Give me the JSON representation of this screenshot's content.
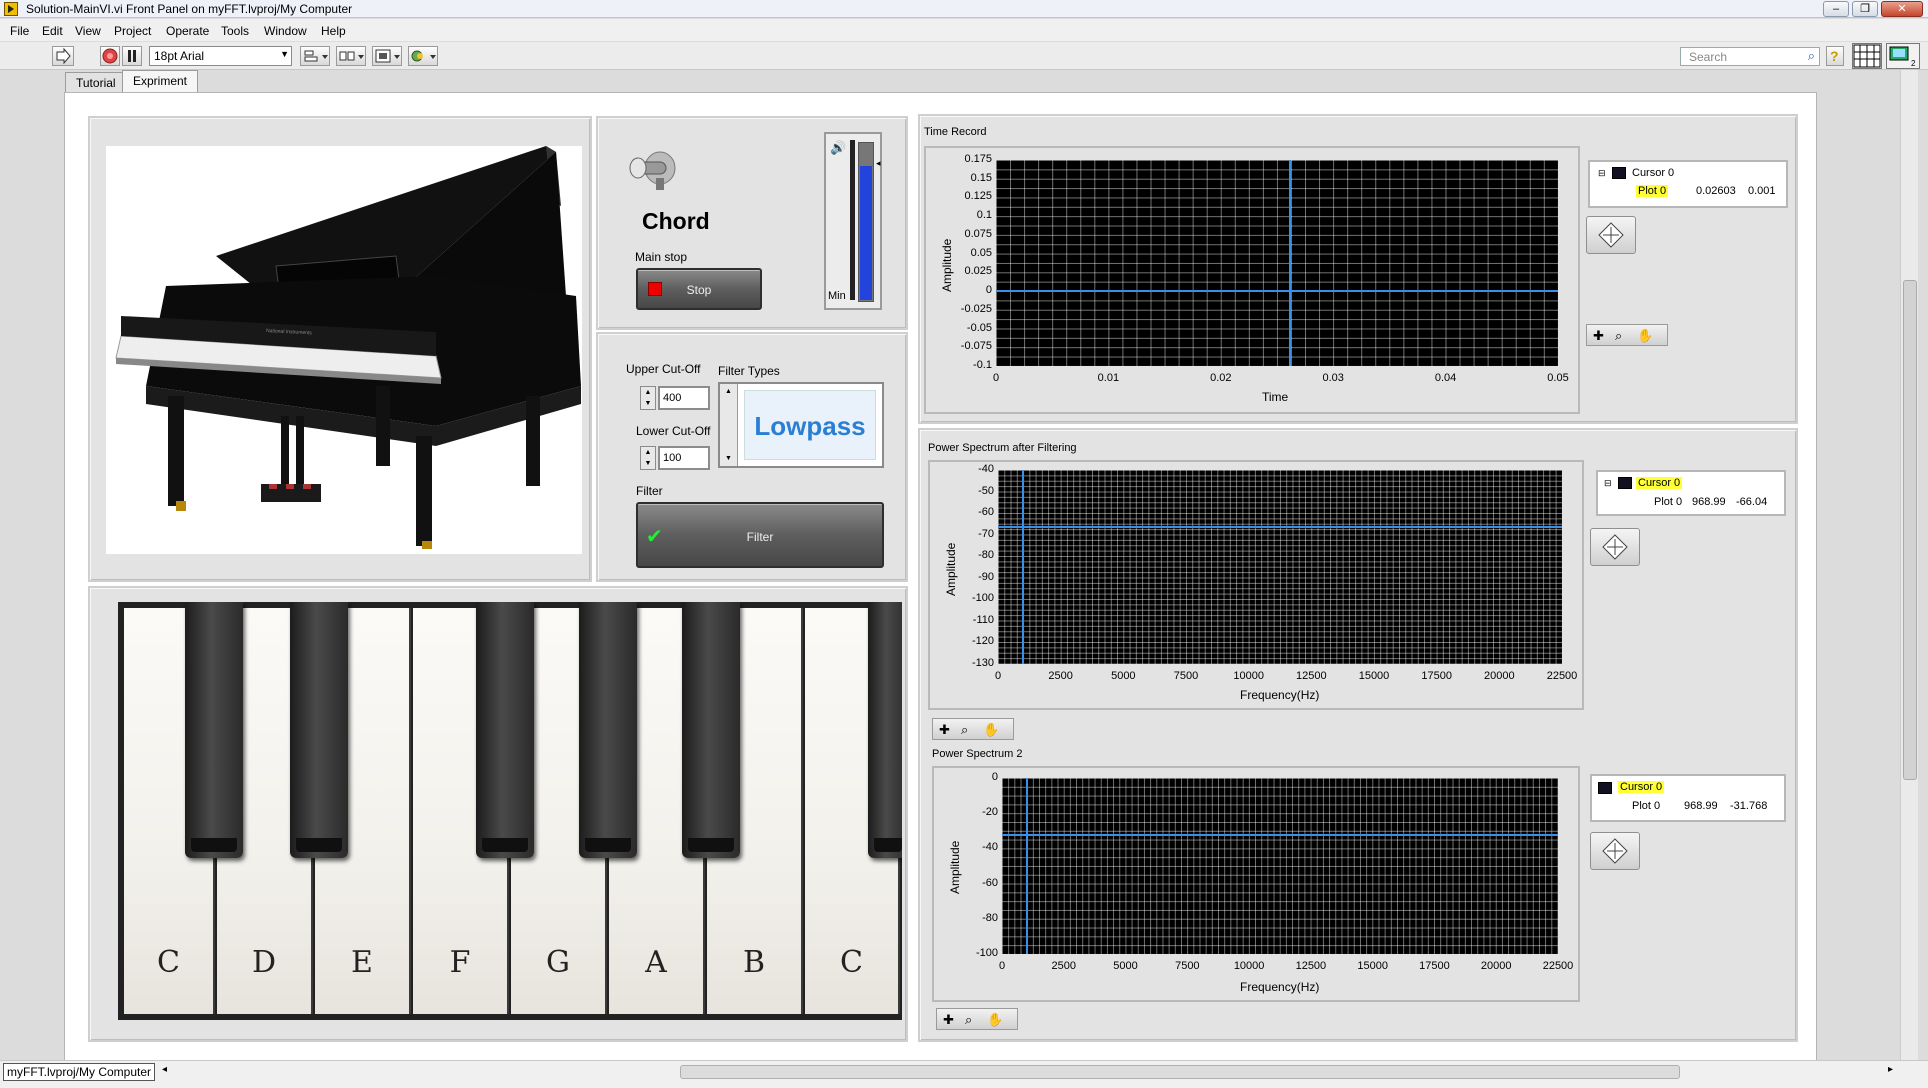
{
  "window": {
    "title": "Solution-MainVI.vi Front Panel on myFFT.lvproj/My Computer",
    "buttons": [
      "–",
      "❐",
      "✕"
    ]
  },
  "menu": [
    "File",
    "Edit",
    "View",
    "Project",
    "Operate",
    "Tools",
    "Window",
    "Help"
  ],
  "toolbar": {
    "font": "18pt Arial",
    "search_placeholder": "Search"
  },
  "tabs": [
    {
      "label": "Tutorial",
      "active": false
    },
    {
      "label": "Expriment",
      "active": true
    }
  ],
  "controls": {
    "chord_label": "Chord",
    "main_stop_label": "Main stop",
    "stop_button": "Stop",
    "volume_min": "Min",
    "upper_cutoff_label": "Upper Cut-Off",
    "upper_cutoff_value": "400",
    "lower_cutoff_label": "Lower Cut-Off",
    "lower_cutoff_value": "100",
    "filter_types_label": "Filter Types",
    "filter_type_value": "Lowpass",
    "filter_label": "Filter",
    "filter_button": "Filter",
    "volume_level": 0.85
  },
  "keyboard": {
    "white_keys": [
      "C",
      "D",
      "E",
      "F",
      "G",
      "A",
      "B",
      "C"
    ]
  },
  "graphs": {
    "time_record": {
      "title": "Time Record",
      "ylabel": "Amplitude",
      "xlabel": "Time",
      "yticks": [
        "0.175",
        "0.15",
        "0.125",
        "0.1",
        "0.075",
        "0.05",
        "0.025",
        "0",
        "-0.025",
        "-0.05",
        "-0.075",
        "-0.1"
      ],
      "xticks": [
        "0",
        "0.01",
        "0.02",
        "0.03",
        "0.04",
        "0.05"
      ],
      "cursor": {
        "name": "Cursor 0",
        "plot": "Plot 0",
        "x": "0.02603",
        "y": "0.001"
      }
    },
    "power_after": {
      "title": "Power Spectrum after Filtering",
      "ylabel": "Amplitude",
      "xlabel": "Frequency(Hz)",
      "yticks": [
        "-40",
        "-50",
        "-60",
        "-70",
        "-80",
        "-90",
        "-100",
        "-110",
        "-120",
        "-130"
      ],
      "xticks": [
        "0",
        "2500",
        "5000",
        "7500",
        "10000",
        "12500",
        "15000",
        "17500",
        "20000",
        "22500"
      ],
      "cursor": {
        "name": "Cursor 0",
        "plot": "Plot 0",
        "x": "968.99",
        "y": "-66.04"
      }
    },
    "power_2": {
      "title": "Power Spectrum 2",
      "ylabel": "Amplitude",
      "xlabel": "Frequency(Hz)",
      "yticks": [
        "0",
        "-20",
        "-40",
        "-60",
        "-80",
        "-100"
      ],
      "xticks": [
        "0",
        "2500",
        "5000",
        "7500",
        "10000",
        "12500",
        "15000",
        "17500",
        "20000",
        "22500"
      ],
      "cursor": {
        "name": "Cursor 0",
        "plot": "Plot 0",
        "x": "968.99",
        "y": "-31.768"
      }
    }
  },
  "status": {
    "project_path": "myFFT.lvproj/My Computer"
  },
  "chart_data": [
    {
      "type": "line",
      "title": "Time Record",
      "xlabel": "Time",
      "ylabel": "Amplitude",
      "xlim": [
        0,
        0.05
      ],
      "ylim": [
        -0.1,
        0.175
      ],
      "cursor": {
        "x": 0.02603,
        "y": 0.001
      },
      "series": [
        {
          "values": [
            0,
            0,
            0,
            0,
            0,
            0
          ]
        }
      ],
      "x": [
        0,
        0.01,
        0.02,
        0.03,
        0.04,
        0.05
      ]
    },
    {
      "type": "line",
      "title": "Power Spectrum after Filtering",
      "xlabel": "Frequency(Hz)",
      "ylabel": "Amplitude",
      "xlim": [
        0,
        22500
      ],
      "ylim": [
        -130,
        -40
      ],
      "cursor": {
        "x": 968.99,
        "y": -66.04
      }
    },
    {
      "type": "line",
      "title": "Power Spectrum 2",
      "xlabel": "Frequency(Hz)",
      "ylabel": "Amplitude",
      "xlim": [
        0,
        22500
      ],
      "ylim": [
        -100,
        0
      ],
      "cursor": {
        "x": 968.99,
        "y": -31.768
      }
    }
  ]
}
